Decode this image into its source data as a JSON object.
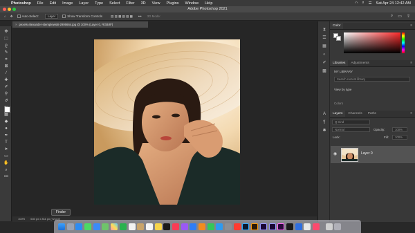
{
  "menubar": {
    "app_name": "Photoshop",
    "menus": [
      "File",
      "Edit",
      "Image",
      "Layer",
      "Type",
      "Select",
      "Filter",
      "3D",
      "View",
      "Plugins",
      "Window",
      "Help"
    ],
    "datetime": "Sat Apr 24  12:42 AM"
  },
  "window": {
    "title": "Adobe Photoshop 2021"
  },
  "options_bar": {
    "auto_select_label": "Auto-Select:",
    "auto_select_value": "Layer",
    "transform_label": "Show Transform Controls",
    "mode_3d": "3D Mode:"
  },
  "document": {
    "tab_title": "pexels-alexander-stemplewski-2906664.jpg @ 100% (Layer 0, RGB/8*)",
    "zoom": "100%",
    "size": "640 px x 811 px (72 ppi)"
  },
  "tooltip": {
    "text": "Finder"
  },
  "panels": {
    "color_tab": "Color",
    "libraries_tab": "Libraries",
    "adjustments_tab": "Adjustments",
    "library_name": "MY LIBRARY",
    "library_search_placeholder": "Search current library",
    "view_by": "View by type",
    "layers_tab": "Layers",
    "channels_tab": "Channels",
    "paths_tab": "Paths",
    "kind_filter": "Q Kind",
    "blend_mode": "Normal",
    "opacity_label": "Opacity:",
    "opacity_value": "100%",
    "lock_label": "Lock:",
    "fill_label": "Fill:",
    "fill_value": "100%",
    "layer_name": "Layer 0",
    "colors_label": "Colors"
  },
  "colors": {
    "accent_red": "#ff2a2a",
    "panel_bg": "#383838",
    "canvas_bg": "#262626"
  }
}
